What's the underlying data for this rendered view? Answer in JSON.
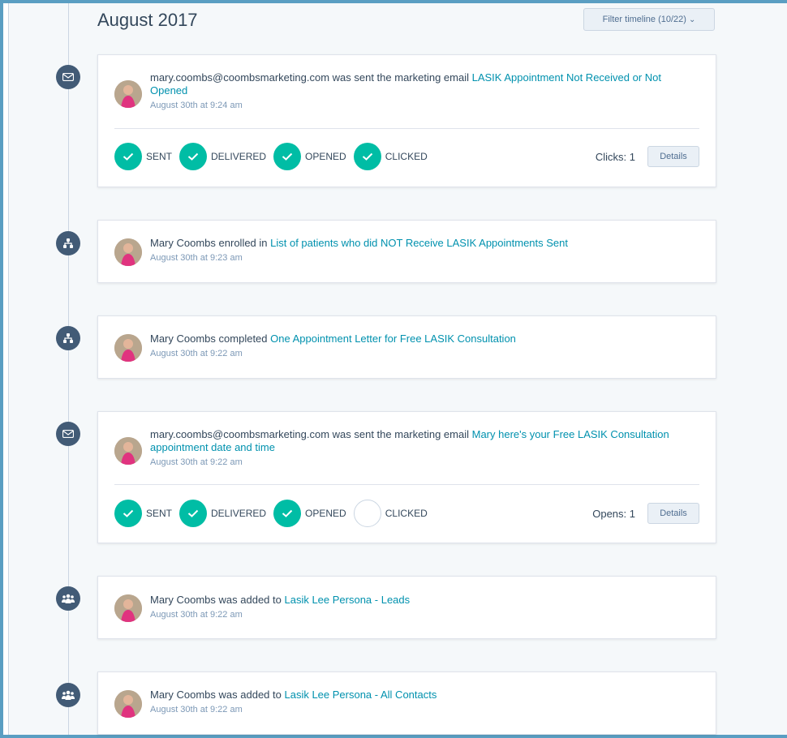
{
  "timeline": {
    "month": "August 2017",
    "filter_label": "Filter timeline (10/22)",
    "filter_chevron": "⌄"
  },
  "events": [
    {
      "type": "email",
      "icon": "envelope-icon",
      "actor": "mary.coombs@coombsmarketing.com",
      "verb": " was sent the marketing email ",
      "link": "LASIK Appointment Not Received or Not Opened",
      "time": "August 30th at 9:24 am",
      "statuses": [
        {
          "label": "SENT",
          "done": true
        },
        {
          "label": "DELIVERED",
          "done": true
        },
        {
          "label": "OPENED",
          "done": true
        },
        {
          "label": "CLICKED",
          "done": true
        }
      ],
      "metric": "Clicks: 1",
      "details_label": "Details"
    },
    {
      "type": "workflow",
      "icon": "workflow-icon",
      "actor": "Mary Coombs",
      "verb": " enrolled in ",
      "link": "List of patients who did NOT Receive LASIK Appointments Sent",
      "time": "August 30th at 9:23 am"
    },
    {
      "type": "workflow",
      "icon": "workflow-icon",
      "actor": "Mary Coombs",
      "verb": " completed ",
      "link": "One Appointment Letter for Free LASIK Consultation",
      "time": "August 30th at 9:22 am"
    },
    {
      "type": "email",
      "icon": "envelope-icon",
      "actor": "mary.coombs@coombsmarketing.com",
      "verb": " was sent the marketing email ",
      "link": "Mary here's your Free LASIK Consultation appointment date and time",
      "time": "August 30th at 9:22 am",
      "statuses": [
        {
          "label": "SENT",
          "done": true
        },
        {
          "label": "DELIVERED",
          "done": true
        },
        {
          "label": "OPENED",
          "done": true
        },
        {
          "label": "CLICKED",
          "done": false
        }
      ],
      "metric": "Opens: 1",
      "details_label": "Details"
    },
    {
      "type": "list",
      "icon": "people-icon",
      "actor": "Mary Coombs",
      "verb": " was added to ",
      "link": "Lasik Lee Persona - Leads",
      "time": "August 30th at 9:22 am"
    },
    {
      "type": "list",
      "icon": "people-icon",
      "actor": "Mary Coombs",
      "verb": " was added to ",
      "link": "Lasik Lee Persona - All Contacts",
      "time": "August 30th at 9:22 am"
    }
  ],
  "colors": {
    "accent": "#00bda5",
    "link": "#0091ae",
    "marker": "#425b76",
    "frame": "#5a9ec2"
  }
}
